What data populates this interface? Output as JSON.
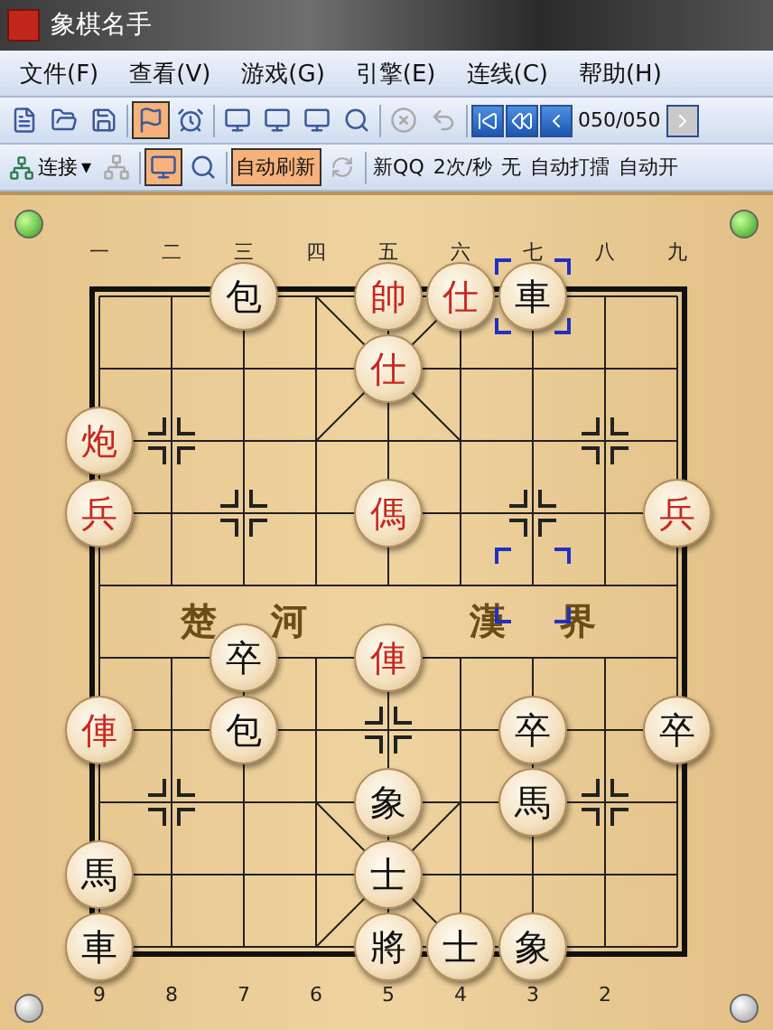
{
  "window": {
    "title": "象棋名手"
  },
  "menu": [
    {
      "label": "文件(F)"
    },
    {
      "label": "查看(V)"
    },
    {
      "label": "游戏(G)"
    },
    {
      "label": "引擎(E)"
    },
    {
      "label": "连线(C)"
    },
    {
      "label": "帮助(H)"
    }
  ],
  "toolbar": {
    "buttons": [
      {
        "pressed": false,
        "disabled": false
      },
      {
        "pressed": false,
        "disabled": false
      },
      {
        "pressed": false,
        "disabled": false
      },
      {
        "pressed": true,
        "disabled": false
      },
      {
        "pressed": false,
        "disabled": false
      },
      {
        "pressed": false,
        "disabled": false
      },
      {
        "pressed": false,
        "disabled": false
      },
      {
        "pressed": false,
        "disabled": false
      },
      {
        "pressed": false,
        "disabled": false
      },
      {
        "pressed": false,
        "disabled": true
      },
      {
        "pressed": false,
        "disabled": true
      }
    ],
    "nav_buttons": [
      {
        "disabled": false
      },
      {
        "disabled": false
      },
      {
        "disabled": false
      }
    ],
    "move_counter": "050/050",
    "next_button": {
      "disabled": true
    }
  },
  "online_bar": {
    "connect": "连接",
    "connect_caret": "▾",
    "icons": [
      {
        "pressed": false,
        "disabled": true
      },
      {
        "pressed": true,
        "disabled": false
      },
      {
        "pressed": false,
        "disabled": false
      }
    ],
    "auto_refresh": {
      "label": "自动刷新",
      "pressed": true
    },
    "texts": [
      "新QQ",
      "2次/秒",
      "无",
      "自动打擂",
      "自动开"
    ]
  },
  "board": {
    "top_labels": [
      "一",
      "二",
      "三",
      "四",
      "五",
      "六",
      "七",
      "八",
      "九"
    ],
    "bottom_labels": [
      "9",
      "8",
      "7",
      "6",
      "5",
      "4",
      "3",
      "2"
    ],
    "river": [
      "楚河",
      "漢界"
    ],
    "rows": [
      {
        "cells": [
          null,
          null,
          {
            "kind": "piece",
            "label": "包",
            "color": "#111111",
            "selected": false
          },
          null,
          {
            "kind": "piece",
            "label": "帥",
            "color": "#c8281e",
            "selected": false
          },
          {
            "kind": "piece",
            "label": "仕",
            "color": "#c8281e",
            "selected": false
          },
          {
            "kind": "piece",
            "label": "車",
            "color": "#111111",
            "selected": true
          },
          null,
          null
        ]
      },
      {
        "cells": [
          null,
          null,
          null,
          null,
          {
            "kind": "piece",
            "label": "仕",
            "color": "#c8281e",
            "selected": false
          },
          null,
          null,
          null,
          null
        ]
      },
      {
        "cells": [
          {
            "kind": "piece",
            "label": "炮",
            "color": "#c8281e",
            "selected": false
          },
          null,
          null,
          null,
          null,
          null,
          null,
          null,
          null
        ]
      },
      {
        "cells": [
          {
            "kind": "piece",
            "label": "兵",
            "color": "#c8281e",
            "selected": false
          },
          null,
          null,
          null,
          {
            "kind": "piece",
            "label": "傌",
            "color": "#c8281e",
            "selected": false
          },
          null,
          null,
          null,
          {
            "kind": "piece",
            "label": "兵",
            "color": "#c8281e",
            "selected": false
          }
        ]
      },
      {
        "cells": [
          null,
          null,
          null,
          null,
          null,
          null,
          {
            "kind": "marker"
          },
          null,
          null
        ]
      },
      {
        "cells": [
          null,
          null,
          {
            "kind": "piece",
            "label": "卒",
            "color": "#111111",
            "selected": false
          },
          null,
          {
            "kind": "piece",
            "label": "俥",
            "color": "#c8281e",
            "selected": false
          },
          null,
          null,
          null,
          null
        ]
      },
      {
        "cells": [
          {
            "kind": "piece",
            "label": "俥",
            "color": "#c8281e",
            "selected": false
          },
          null,
          {
            "kind": "piece",
            "label": "包",
            "color": "#111111",
            "selected": false
          },
          null,
          null,
          null,
          {
            "kind": "piece",
            "label": "卒",
            "color": "#111111",
            "selected": false
          },
          null,
          {
            "kind": "piece",
            "label": "卒",
            "color": "#111111",
            "selected": false
          }
        ]
      },
      {
        "cells": [
          null,
          null,
          null,
          null,
          {
            "kind": "piece",
            "label": "象",
            "color": "#111111",
            "selected": false
          },
          null,
          {
            "kind": "piece",
            "label": "馬",
            "color": "#111111",
            "selected": false
          },
          null,
          null
        ]
      },
      {
        "cells": [
          {
            "kind": "piece",
            "label": "馬",
            "color": "#111111",
            "selected": false
          },
          null,
          null,
          null,
          {
            "kind": "piece",
            "label": "士",
            "color": "#111111",
            "selected": false
          },
          null,
          null,
          null,
          null
        ]
      },
      {
        "cells": [
          {
            "kind": "piece",
            "label": "車",
            "color": "#111111",
            "selected": false
          },
          null,
          null,
          null,
          {
            "kind": "piece",
            "label": "將",
            "color": "#111111",
            "selected": false
          },
          {
            "kind": "piece",
            "label": "士",
            "color": "#111111",
            "selected": false
          },
          {
            "kind": "piece",
            "label": "象",
            "color": "#111111",
            "selected": false
          },
          null,
          null
        ]
      }
    ]
  }
}
